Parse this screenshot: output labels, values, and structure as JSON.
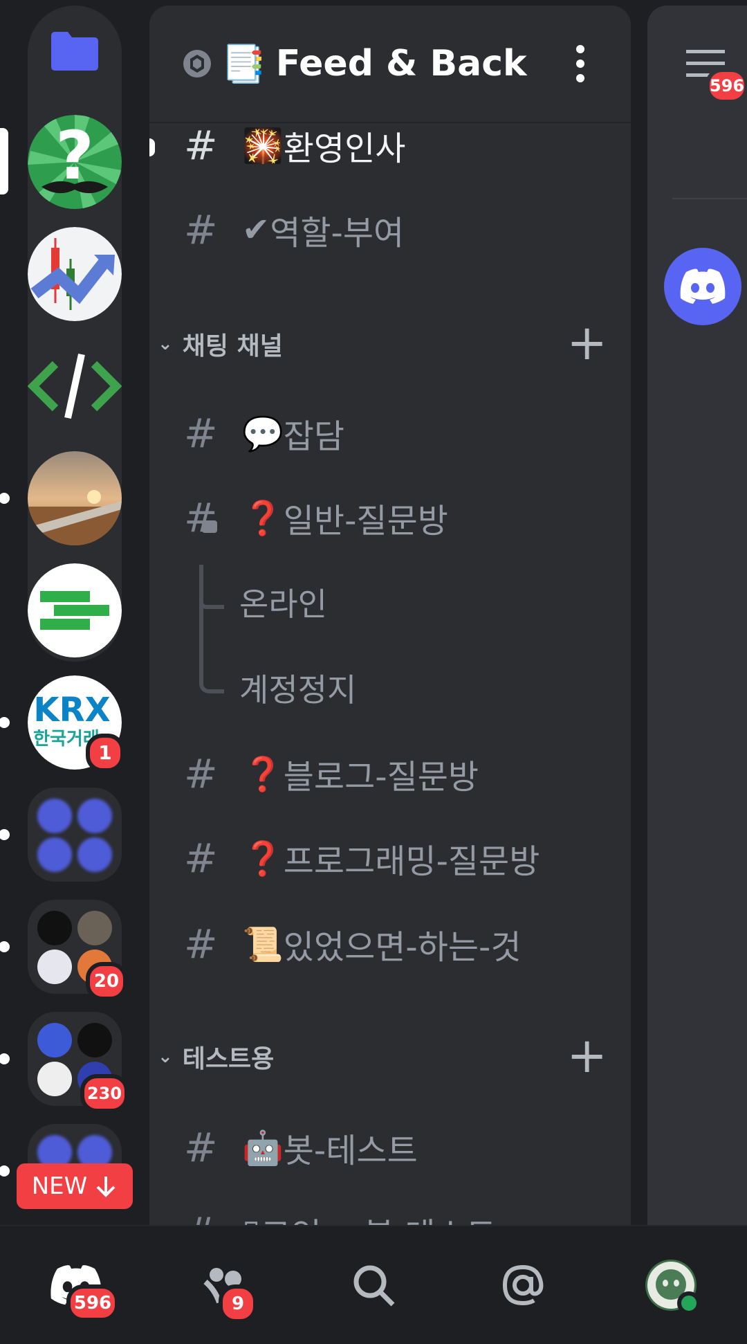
{
  "server": {
    "name": "Feed & Back",
    "name_emoji": "📑"
  },
  "channels_top": [
    {
      "emoji": "🎇",
      "name": "환영인사",
      "active": true
    },
    {
      "emoji": "✔",
      "name": "역할-부여",
      "active": false
    }
  ],
  "categories": [
    {
      "label": "채팅 채널"
    },
    {
      "label": "테스트용"
    }
  ],
  "chat_channels": [
    {
      "emoji": "💬",
      "name": "잡담"
    },
    {
      "emoji": "❓",
      "name": "일반-질문방"
    }
  ],
  "threads": [
    "온라인",
    "계정정지"
  ],
  "chat_channels_after": [
    {
      "emoji": "❓",
      "name": "블로그-질문방"
    },
    {
      "emoji": "❓",
      "name": "프로그래밍-질문방"
    },
    {
      "emoji": "📜",
      "name": "있었으면-하는-것"
    }
  ],
  "test_channels": [
    {
      "emoji": "🤖",
      "name": "봇-테스트"
    },
    {
      "emoji": "▯",
      "name": "코인 ·  ̣ 봇 테스트"
    }
  ],
  "badges": {
    "krx": "1",
    "folder2": "20",
    "folder3": "230",
    "members": "596",
    "home": "596",
    "friends": "9"
  },
  "new_button": {
    "label": "NEW",
    "icon": "arrow-down-icon"
  },
  "icons": {
    "folder": "folder-icon",
    "settings": "gear-icon",
    "more": "vertical-dots-icon",
    "members": "members-list-icon",
    "home": "discord-home-icon",
    "friends": "friends-icon",
    "search": "search-icon",
    "mentions": "at-icon",
    "profile": "avatar-icon"
  },
  "colors": {
    "background": "#1e1f22",
    "panel": "#2b2d31",
    "badge": "#f23f43",
    "blurple": "#5865f2",
    "online": "#23a55a"
  }
}
